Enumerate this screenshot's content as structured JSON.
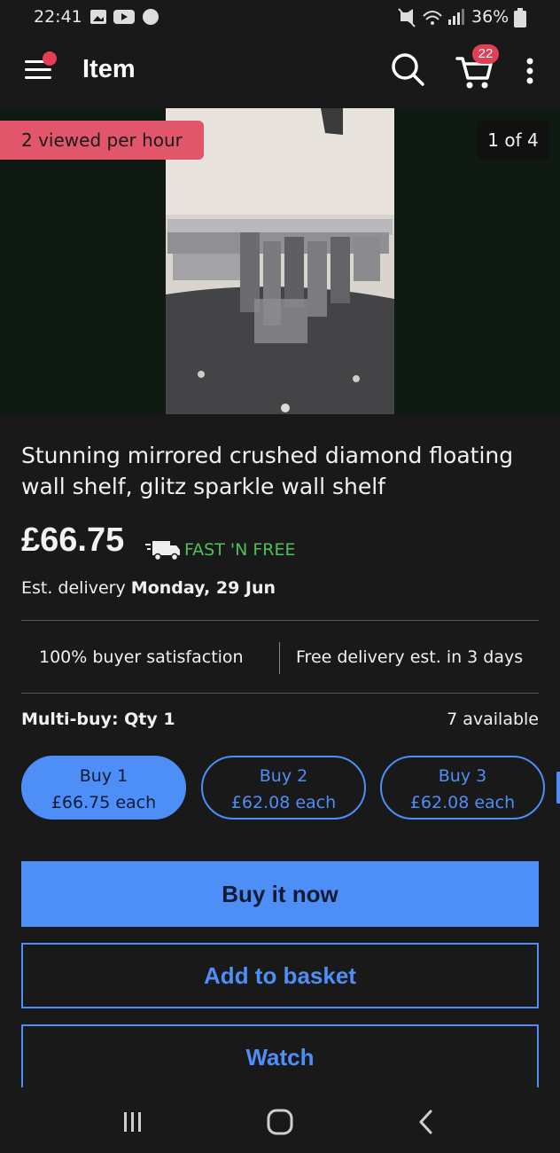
{
  "status_bar": {
    "time": "22:41",
    "battery": "36%"
  },
  "app_bar": {
    "title": "Item",
    "cart_count": "22",
    "icons": [
      "menu-icon",
      "search-icon",
      "cart-icon",
      "more-icon"
    ]
  },
  "gallery": {
    "viewed_badge": "2 viewed per hour",
    "counter": "1 of 4"
  },
  "item": {
    "title": "Stunning mirrored crushed diamond floating wall shelf, glitz sparkle wall shelf",
    "price": "£66.75",
    "shipping_label": "FAST 'N FREE",
    "delivery_prefix": "Est. delivery",
    "delivery_date": "Monday, 29 Jun"
  },
  "highlights": {
    "satisfaction": "100% buyer satisfaction",
    "free_delivery": "Free delivery est. in 3 days"
  },
  "multibuy": {
    "label": "Multi-buy: Qty 1",
    "available": "7 available",
    "options": [
      {
        "line1": "Buy 1",
        "line2": "£66.75 each",
        "selected": true
      },
      {
        "line1": "Buy 2",
        "line2": "£62.08 each",
        "selected": false
      },
      {
        "line1": "Buy 3",
        "line2": "£62.08 each",
        "selected": false
      }
    ]
  },
  "actions": {
    "buy_now": "Buy it now",
    "add_to_basket": "Add to basket",
    "watch": "Watch"
  },
  "colors": {
    "accent": "#4e8ef7",
    "badge": "#e1566a",
    "fast_free": "#4ec05a",
    "background": "#191919"
  }
}
